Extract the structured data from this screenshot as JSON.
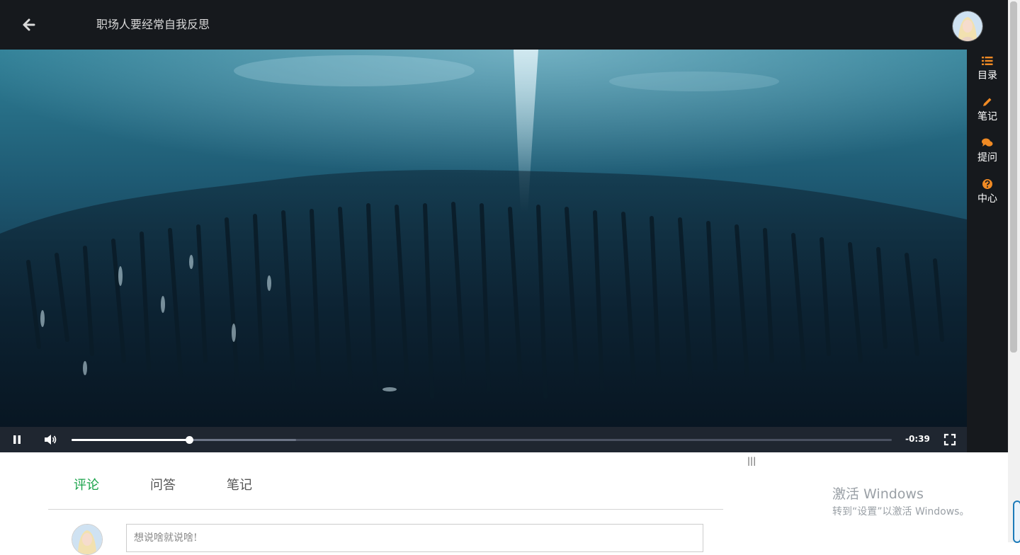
{
  "header": {
    "title": "职场人要经常自我反思",
    "back_icon": "arrow-left-icon",
    "avatar_icon": "user-avatar"
  },
  "player": {
    "time_remaining": "-0:39",
    "progress_fraction": 0.143,
    "buffered_fraction": 0.274,
    "icons": [
      "pause-icon",
      "volume-icon",
      "fullscreen-icon"
    ]
  },
  "sidebar": {
    "accent_color": "#f08a24",
    "items": [
      {
        "label": "目录",
        "icon": "list-icon"
      },
      {
        "label": "笔记",
        "icon": "pencil-icon"
      },
      {
        "label": "提问",
        "icon": "comments-icon"
      },
      {
        "label": "中心",
        "icon": "question-circle-icon"
      }
    ]
  },
  "tabs": [
    {
      "label": "评论",
      "active": true
    },
    {
      "label": "问答",
      "active": false
    },
    {
      "label": "笔记",
      "active": false
    }
  ],
  "comment": {
    "placeholder": "想说啥就说啥!"
  },
  "watermark": {
    "line1": "激活 Windows",
    "line2": "转到“设置”以激活 Windows。"
  },
  "colors": {
    "active_tab": "#1aa34a",
    "header_bg": "#16191d",
    "controls_bg": "#1f2630"
  }
}
